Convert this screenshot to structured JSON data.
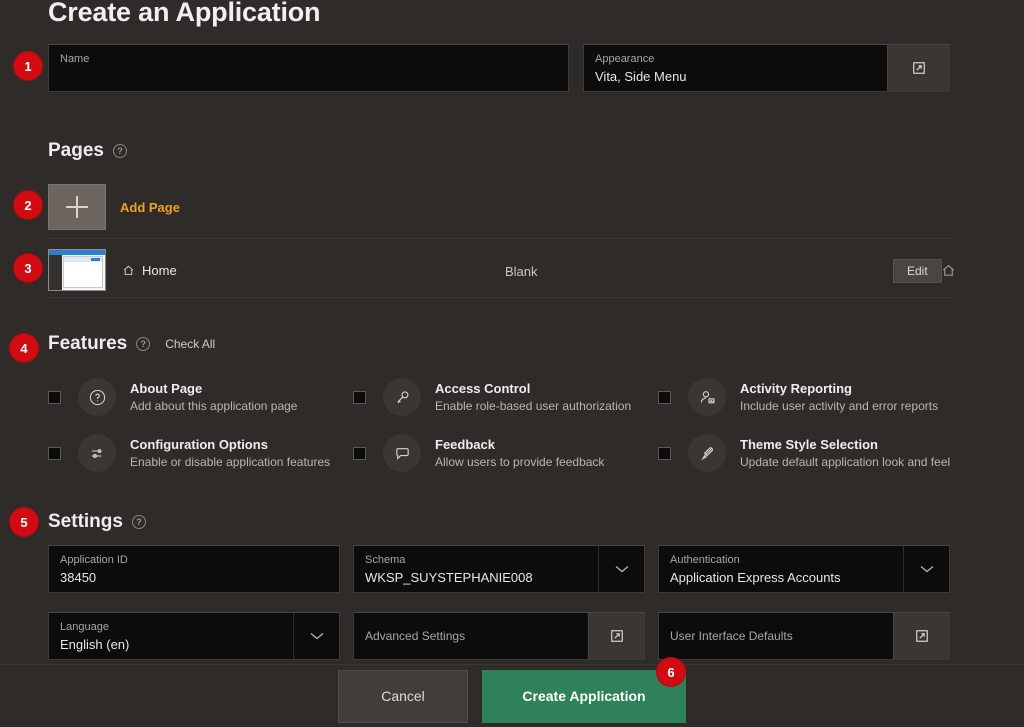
{
  "page_title": "Create an Application",
  "name_field": {
    "label": "Name",
    "value": "",
    "placeholder": ""
  },
  "appearance_field": {
    "label": "Appearance",
    "value": "Vita, Side Menu",
    "addon_icon": "external-link-icon"
  },
  "pages_section": {
    "heading": "Pages",
    "help_icon": "help-icon",
    "add_page_label": "Add Page",
    "rows": [
      {
        "name": "Home",
        "icon": "home-icon",
        "type": "Blank",
        "edit_label": "Edit",
        "row_icon": "home-icon"
      }
    ]
  },
  "features_section": {
    "heading": "Features",
    "help_icon": "help-icon",
    "check_all_label": "Check All",
    "items": [
      {
        "title": "About Page",
        "desc": "Add about this application page",
        "icon": "question-circle-icon",
        "checked": false
      },
      {
        "title": "Access Control",
        "desc": "Enable role-based user authorization",
        "icon": "key-icon",
        "checked": false
      },
      {
        "title": "Activity Reporting",
        "desc": "Include user activity and error reports",
        "icon": "user-chart-icon",
        "checked": false
      },
      {
        "title": "Configuration Options",
        "desc": "Enable or disable application features",
        "icon": "sliders-icon",
        "checked": false
      },
      {
        "title": "Feedback",
        "desc": "Allow users to provide feedback",
        "icon": "comment-icon",
        "checked": false
      },
      {
        "title": "Theme Style Selection",
        "desc": "Update default application look and feel",
        "icon": "brush-icon",
        "checked": false
      }
    ]
  },
  "settings_section": {
    "heading": "Settings",
    "help_icon": "help-icon",
    "fields": [
      {
        "label": "Application ID",
        "value": "38450",
        "addon": "none"
      },
      {
        "label": "Schema",
        "value": "WKSP_SUYSTEPHANIE008",
        "addon": "chevron-down-icon"
      },
      {
        "label": "Authentication",
        "value": "Application Express Accounts",
        "addon": "chevron-down-icon"
      },
      {
        "label": "Language",
        "value": "English (en)",
        "addon": "chevron-down-icon"
      },
      {
        "label": "Advanced Settings",
        "value": "",
        "addon": "external-link-icon"
      },
      {
        "label": "User Interface Defaults",
        "value": "",
        "addon": "external-link-icon"
      }
    ]
  },
  "footer": {
    "cancel_label": "Cancel",
    "create_label": "Create Application"
  },
  "step_badges": [
    "1",
    "2",
    "3",
    "4",
    "5",
    "6"
  ],
  "colors": {
    "background": "#2e2b29",
    "field_background": "#0d0c0c",
    "accent_orange": "#f0a02a",
    "badge_red": "#d00b12",
    "create_green": "#2e8159"
  }
}
